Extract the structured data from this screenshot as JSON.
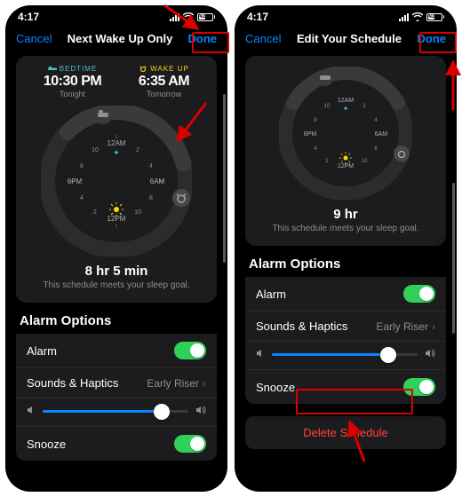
{
  "status": {
    "time": "4:17",
    "battery": "41"
  },
  "colors": {
    "accent": "#0a84ff",
    "green": "#30d158",
    "red": "#ff453a",
    "teal": "#46c1c0",
    "yellow": "#ffd60a"
  },
  "left": {
    "nav": {
      "cancel": "Cancel",
      "title": "Next Wake Up Only",
      "done": "Done"
    },
    "bedtime": {
      "header": "BEDTIME",
      "value": "10:30 PM",
      "sub": "Tonight"
    },
    "wakeup": {
      "header": "WAKE UP",
      "value": "6:35 AM",
      "sub": "Tomorrow"
    },
    "dial_hours": [
      "12AM",
      "2",
      "4",
      "6AM",
      "8",
      "10",
      "12PM",
      "2",
      "4",
      "6PM",
      "8",
      "10"
    ],
    "summary": {
      "big": "8 hr 5 min",
      "sub": "This schedule meets your sleep goal."
    },
    "alarm_section": "Alarm Options",
    "rows": {
      "alarm": "Alarm",
      "sounds": "Sounds & Haptics",
      "sounds_value": "Early Riser",
      "snooze": "Snooze"
    },
    "slider_pct": 82
  },
  "right": {
    "nav": {
      "cancel": "Cancel",
      "title": "Edit Your Schedule",
      "done": "Done"
    },
    "dial_hours": [
      "12AM",
      "2",
      "4",
      "6AM",
      "8",
      "10",
      "12PM",
      "2",
      "4",
      "6PM",
      "8",
      "10"
    ],
    "summary": {
      "big": "9 hr",
      "sub": "This schedule meets your sleep goal."
    },
    "alarm_section": "Alarm Options",
    "rows": {
      "alarm": "Alarm",
      "sounds": "Sounds & Haptics",
      "sounds_value": "Early Riser",
      "snooze": "Snooze"
    },
    "slider_pct": 80,
    "delete": "Delete Schedule"
  }
}
